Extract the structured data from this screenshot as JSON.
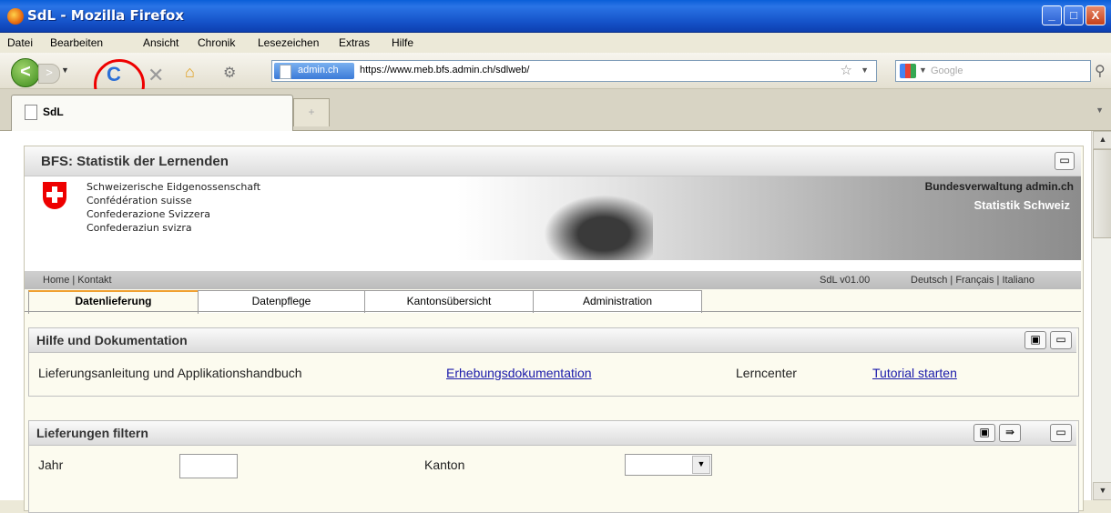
{
  "window": {
    "title": "SdL - Mozilla Firefox",
    "minimize": "_",
    "maximize": "□",
    "close": "X"
  },
  "menu": [
    "Datei",
    "Bearbeiten",
    "Ansicht",
    "Chronik",
    "Lesezeichen",
    "Extras",
    "Hilfe"
  ],
  "nav": {
    "back": "<",
    "forward": ">",
    "reload": "C",
    "stop": "✕",
    "home": "⌂",
    "extension": "⚙",
    "site_badge": "admin.ch",
    "url": "https://www.meb.bfs.admin.ch/sdlweb/",
    "search_placeholder": "Google"
  },
  "tabs": {
    "active": "SdL",
    "new_tab": "+"
  },
  "app": {
    "title": "BFS: Statistik der Lernenden",
    "confederation": [
      "Schweizerische Eidgenossenschaft",
      "Confédération suisse",
      "Confederazione Svizzera",
      "Confederaziun svizra"
    ],
    "admin_label": "Bundesverwaltung admin.ch",
    "stat_label": "Statistik Schweiz",
    "links_left": "Home | Kontakt",
    "version": "SdL v01.00",
    "languages": "Deutsch | Français | Italiano",
    "tabs": [
      "Datenlieferung",
      "Datenpflege",
      "Kantonsübersicht",
      "Administration"
    ],
    "help_panel": {
      "title": "Hilfe und Dokumentation",
      "text1": "Lieferungsanleitung und Applikationshandbuch",
      "link1": "Erhebungsdokumentation",
      "text2": "Lerncenter",
      "link2": "Tutorial starten"
    },
    "filter_panel": {
      "title": "Lieferungen filtern",
      "year_label": "Jahr",
      "year_value": "",
      "canton_label": "Kanton",
      "canton_value": ""
    }
  },
  "colors": {
    "highlight_ring": "#e00000",
    "link": "#1a1aaa",
    "tab_accent": "#f0a030"
  }
}
